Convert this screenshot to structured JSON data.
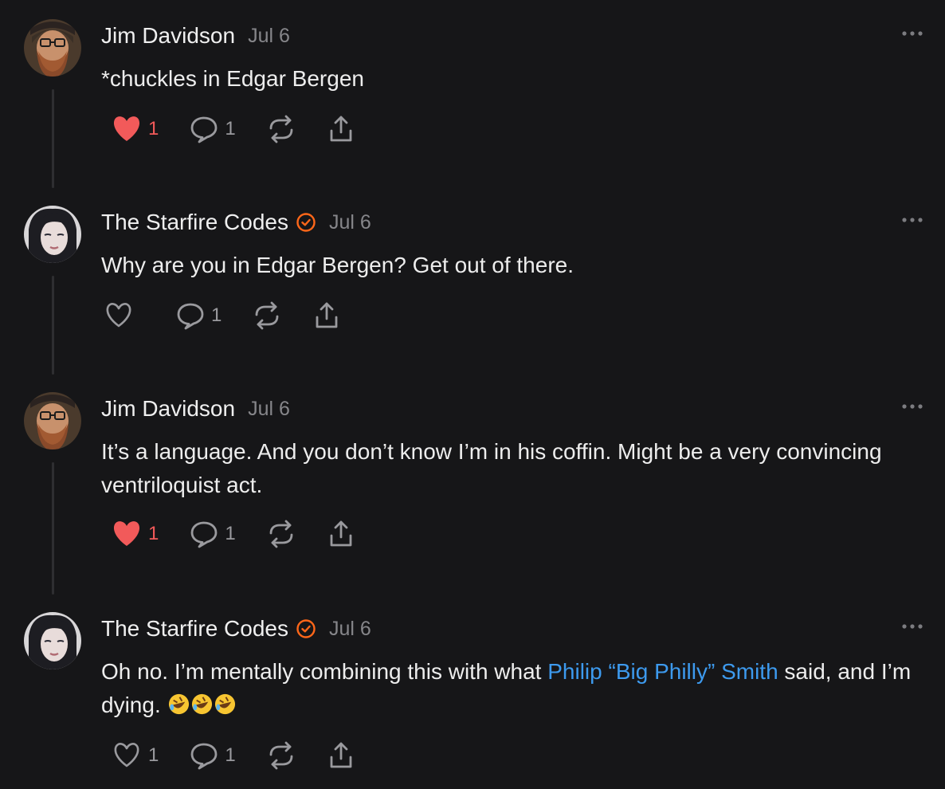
{
  "posts": [
    {
      "author": "Jim Davidson",
      "date": "Jul 6",
      "text": "*chuckles in Edgar Bergen",
      "verified": false,
      "liked": true,
      "like_count": "1",
      "comment_count": "1"
    },
    {
      "author": "The Starfire Codes",
      "date": "Jul 6",
      "text": "Why are you in Edgar Bergen? Get out of there.",
      "verified": true,
      "liked": false,
      "like_count": "",
      "comment_count": "1"
    },
    {
      "author": "Jim Davidson",
      "date": "Jul 6",
      "text": "It’s a language. And you don’t know I’m in his coffin. Might be a very convincing ventriloquist act.",
      "verified": false,
      "liked": true,
      "like_count": "1",
      "comment_count": "1"
    },
    {
      "author": "The Starfire Codes",
      "date": "Jul 6",
      "text_before": "Oh no. I’m mentally combining this with what ",
      "mention": "Philip “Big Philly” Smith",
      "text_after": " said, and I’m dying. ",
      "verified": true,
      "liked": false,
      "like_count": "1",
      "comment_count": "1"
    }
  ],
  "icons": {
    "like": "heart-icon",
    "comment": "comment-bubble-icon",
    "restack": "restack-icon",
    "share": "share-icon",
    "more": "more-options-icon",
    "verified": "verified-check-icon",
    "emoji": "rolling-on-floor-laughing-emoji"
  },
  "colors": {
    "background": "#161618",
    "like_active": "#f25a5a",
    "verified": "#ff6719",
    "mention_link": "#3d9aee",
    "muted": "#86868a"
  }
}
